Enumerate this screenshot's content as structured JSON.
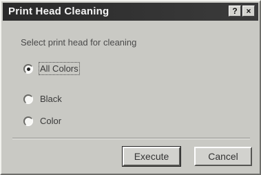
{
  "window": {
    "title": "Print Head Cleaning",
    "help_label": "?",
    "close_label": "×"
  },
  "dialog": {
    "instruction": "Select print head for cleaning",
    "options": [
      {
        "label": "All Colors",
        "selected": true
      },
      {
        "label": "Black",
        "selected": false
      },
      {
        "label": "Color",
        "selected": false
      }
    ],
    "buttons": {
      "execute_label": "Execute",
      "cancel_label": "Cancel"
    }
  }
}
